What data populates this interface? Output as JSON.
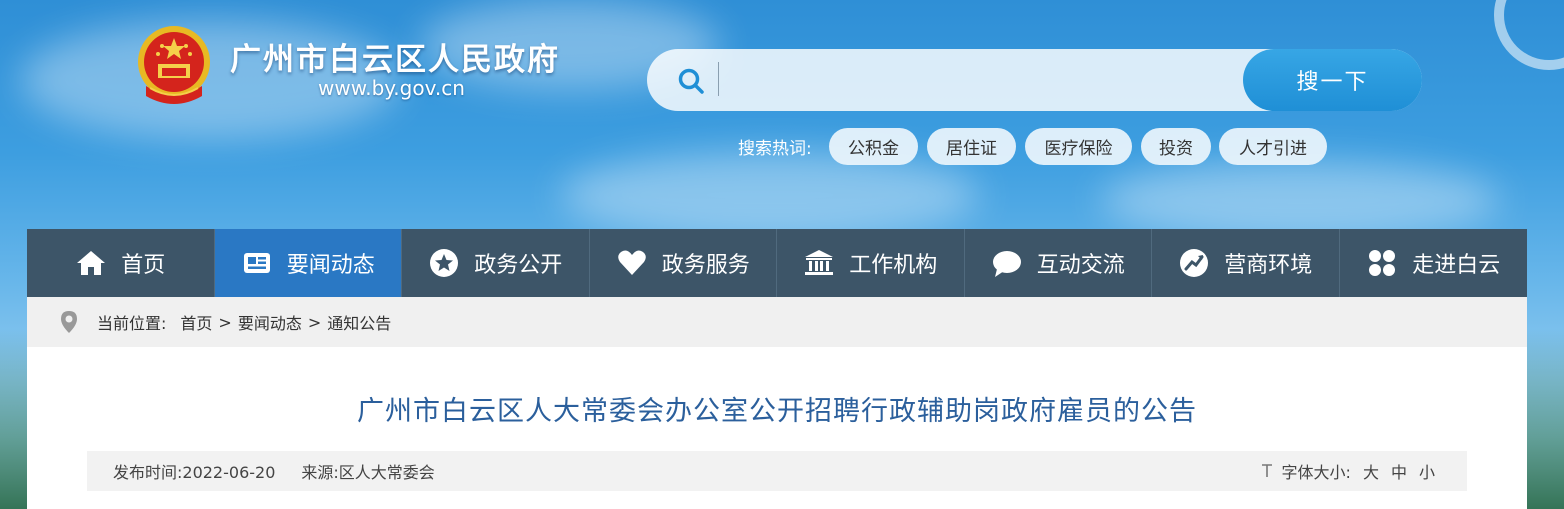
{
  "header": {
    "site_title": "广州市白云区人民政府",
    "site_url": "www.by.gov.cn"
  },
  "search": {
    "placeholder": "",
    "button_label": "搜一下",
    "hot_label": "搜索热词:",
    "hot_terms": [
      "公积金",
      "居住证",
      "医疗保险",
      "投资",
      "人才引进"
    ]
  },
  "nav": {
    "items": [
      {
        "label": "首页",
        "icon": "home-icon"
      },
      {
        "label": "要闻动态",
        "icon": "news-icon",
        "active": true
      },
      {
        "label": "政务公开",
        "icon": "star-icon"
      },
      {
        "label": "政务服务",
        "icon": "heart-icon"
      },
      {
        "label": "工作机构",
        "icon": "institution-icon"
      },
      {
        "label": "互动交流",
        "icon": "chat-icon"
      },
      {
        "label": "营商环境",
        "icon": "business-icon"
      },
      {
        "label": "走进白云",
        "icon": "grid-icon"
      }
    ]
  },
  "breadcrumb": {
    "label": "当前位置:",
    "items": [
      "首页",
      "要闻动态",
      "通知公告"
    ],
    "separator": ">"
  },
  "article": {
    "title": "广州市白云区人大常委会办公室公开招聘行政辅助岗政府雇员的公告",
    "date": "发布时间:2022-06-20",
    "source": "来源:区人大常委会",
    "font_size_label": "字体大小:",
    "font_sizes": [
      "大",
      "中",
      "小"
    ]
  },
  "colors": {
    "nav_bg": "#3d5568",
    "nav_active": "#2a78c4",
    "title_color": "#2b5f9c",
    "search_button": "#1f8fd6"
  }
}
